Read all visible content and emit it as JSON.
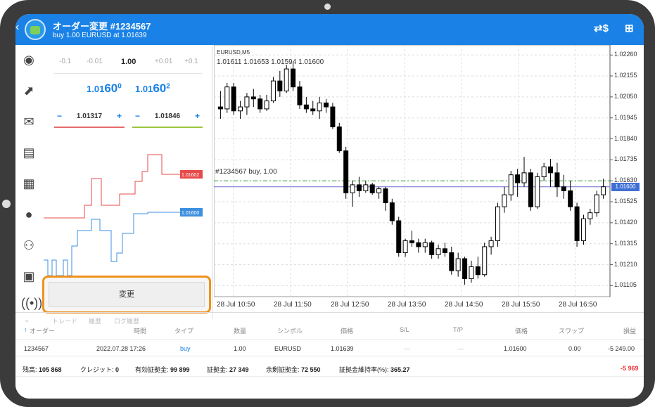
{
  "header": {
    "title": "オーダー変更 #1234567",
    "subtitle": "buy 1.00 EURUSD at 1.01639"
  },
  "icons": {
    "back": "chevron-left-icon",
    "logo": "metatrader-logo-icon",
    "dollar": "dollar-exchange-icon",
    "add": "add-document-icon"
  },
  "volume": {
    "options": [
      "-0.1",
      "-0.01",
      "1.00",
      "+0.01",
      "+0.1"
    ]
  },
  "prices": {
    "bid_prefix": "1.01",
    "bid_big": "60",
    "bid_sup": "0",
    "ask_prefix": "1.01",
    "ask_big": "60",
    "ask_sup": "2"
  },
  "stepper_sl": {
    "minus": "−",
    "value": "1.01317",
    "plus": "+",
    "color": "#e56b6b"
  },
  "stepper_tp": {
    "minus": "−",
    "value": "1.01846",
    "plus": "+",
    "color": "#9bc53d"
  },
  "mini_chart": {
    "ask_label": "1.01602",
    "bid_label": "1.01600",
    "ask_color": "#e84a4a",
    "bid_color": "#3d8fe0"
  },
  "modify_button": "変更",
  "chart": {
    "symbol": "EURUSD,M5",
    "ohlc": "1.01611 1.01653 1.01594 1.01600",
    "order_label": "#1234567   buy, 1.00",
    "price_badge": "1.01600",
    "order_badge": "1.01630",
    "y_labels": [
      "1.02260",
      "1.02155",
      "1.02050",
      "1.01945",
      "1.01840",
      "1.01735",
      "1.01630",
      "1.01525",
      "1.01420",
      "1.01315",
      "1.01210",
      "1.01105"
    ],
    "x_labels": [
      "28 Jul 10:50",
      "28 Jul 11:50",
      "28 Jul 12:50",
      "28 Jul 13:50",
      "28 Jul 14:50",
      "28 Jul 15:50",
      "28 Jul 16:50"
    ]
  },
  "chart_data": {
    "type": "candlestick",
    "x_labels": [
      "28 Jul 10:50",
      "28 Jul 11:50",
      "28 Jul 12:50",
      "28 Jul 13:50",
      "28 Jul 14:50",
      "28 Jul 15:50",
      "28 Jul 16:50"
    ],
    "ylim": [
      1.0105,
      1.0231
    ],
    "candles": [
      [
        1.02,
        1.0208,
        1.0194,
        1.0199
      ],
      [
        1.0199,
        1.0212,
        1.0197,
        1.021
      ],
      [
        1.021,
        1.0212,
        1.0196,
        1.0198
      ],
      [
        1.0198,
        1.0203,
        1.0194,
        1.02
      ],
      [
        1.02,
        1.0207,
        1.0196,
        1.0205
      ],
      [
        1.0205,
        1.0209,
        1.02,
        1.0204
      ],
      [
        1.0204,
        1.0206,
        1.0197,
        1.0199
      ],
      [
        1.0199,
        1.0206,
        1.0198,
        1.0203
      ],
      [
        1.0203,
        1.0215,
        1.0202,
        1.0213
      ],
      [
        1.0213,
        1.0218,
        1.0205,
        1.0208
      ],
      [
        1.0208,
        1.0221,
        1.0207,
        1.0219
      ],
      [
        1.0219,
        1.0222,
        1.0208,
        1.021
      ],
      [
        1.021,
        1.0213,
        1.0199,
        1.0201
      ],
      [
        1.0201,
        1.0205,
        1.0197,
        1.0199
      ],
      [
        1.0199,
        1.0203,
        1.0196,
        1.0198
      ],
      [
        1.0198,
        1.0205,
        1.0194,
        1.0202
      ],
      [
        1.0202,
        1.0204,
        1.0197,
        1.02
      ],
      [
        1.02,
        1.0202,
        1.0189,
        1.019
      ],
      [
        1.019,
        1.0192,
        1.0177,
        1.0178
      ],
      [
        1.0178,
        1.018,
        1.0154,
        1.0157
      ],
      [
        1.0157,
        1.0163,
        1.015,
        1.0161
      ],
      [
        1.0161,
        1.0165,
        1.0155,
        1.0158
      ],
      [
        1.0158,
        1.0163,
        1.0157,
        1.0161
      ],
      [
        1.0161,
        1.0162,
        1.0156,
        1.0157
      ],
      [
        1.0157,
        1.016,
        1.0154,
        1.0159
      ],
      [
        1.0159,
        1.016,
        1.0148,
        1.0152
      ],
      [
        1.0152,
        1.0154,
        1.0141,
        1.0143
      ],
      [
        1.0143,
        1.0145,
        1.0125,
        1.0127
      ],
      [
        1.0127,
        1.0134,
        1.0125,
        1.0133
      ],
      [
        1.0133,
        1.0138,
        1.013,
        1.0132
      ],
      [
        1.0132,
        1.0134,
        1.0127,
        1.013
      ],
      [
        1.013,
        1.0134,
        1.0127,
        1.0132
      ],
      [
        1.0132,
        1.0133,
        1.0124,
        1.0126
      ],
      [
        1.0126,
        1.0131,
        1.0124,
        1.0129
      ],
      [
        1.0129,
        1.0132,
        1.0125,
        1.0127
      ],
      [
        1.0127,
        1.013,
        1.0116,
        1.0118
      ],
      [
        1.0118,
        1.0127,
        1.0115,
        1.0124
      ],
      [
        1.0124,
        1.0125,
        1.0111,
        1.0114
      ],
      [
        1.0114,
        1.0123,
        1.0112,
        1.012
      ],
      [
        1.012,
        1.0125,
        1.0114,
        1.0116
      ],
      [
        1.0116,
        1.0132,
        1.0115,
        1.013
      ],
      [
        1.013,
        1.0135,
        1.0126,
        1.0133
      ],
      [
        1.0133,
        1.0152,
        1.013,
        1.015
      ],
      [
        1.015,
        1.016,
        1.0147,
        1.0156
      ],
      [
        1.0156,
        1.0168,
        1.0153,
        1.0166
      ],
      [
        1.0166,
        1.0169,
        1.0155,
        1.0162
      ],
      [
        1.0162,
        1.0175,
        1.016,
        1.0167
      ],
      [
        1.0167,
        1.0169,
        1.0148,
        1.015
      ],
      [
        1.015,
        1.0167,
        1.0149,
        1.0165
      ],
      [
        1.0165,
        1.0172,
        1.0163,
        1.017
      ],
      [
        1.017,
        1.0174,
        1.016,
        1.0167
      ],
      [
        1.0167,
        1.0172,
        1.0155,
        1.016
      ],
      [
        1.016,
        1.0166,
        1.0154,
        1.0158
      ],
      [
        1.0158,
        1.0163,
        1.0148,
        1.015
      ],
      [
        1.015,
        1.0152,
        1.013,
        1.0133
      ],
      [
        1.0133,
        1.0146,
        1.0131,
        1.0144
      ],
      [
        1.0144,
        1.0149,
        1.0141,
        1.0147
      ],
      [
        1.0147,
        1.0158,
        1.0145,
        1.0156
      ],
      [
        1.0156,
        1.0164,
        1.0154,
        1.016
      ]
    ]
  },
  "tabs": [
    "トレード",
    "履歴",
    "ログ履歴"
  ],
  "table": {
    "headers": [
      "オーダー",
      "時間",
      "タイプ",
      "数量",
      "シンボル",
      "価格",
      "S/L",
      "T/P",
      "価格",
      "スワップ",
      "損益"
    ],
    "rows": [
      [
        "1234567",
        "2022.07.28 17:26",
        "buy",
        "1.00",
        "EURUSD",
        "1.01639",
        "—",
        "—",
        "1.01600",
        "0.00",
        "-5 249.00"
      ]
    ]
  },
  "footer": {
    "balance_label": "残高:",
    "balance": "105 868",
    "credit_label": "クレジット:",
    "credit": "0",
    "equity_label": "有効証拠金:",
    "equity": "99 899",
    "margin_label": "証拠金:",
    "margin": "27 349",
    "free_label": "余剰証拠金:",
    "free": "72 550",
    "level_label": "証拠金維持率(%):",
    "level": "365.27",
    "total": "-5 969"
  }
}
